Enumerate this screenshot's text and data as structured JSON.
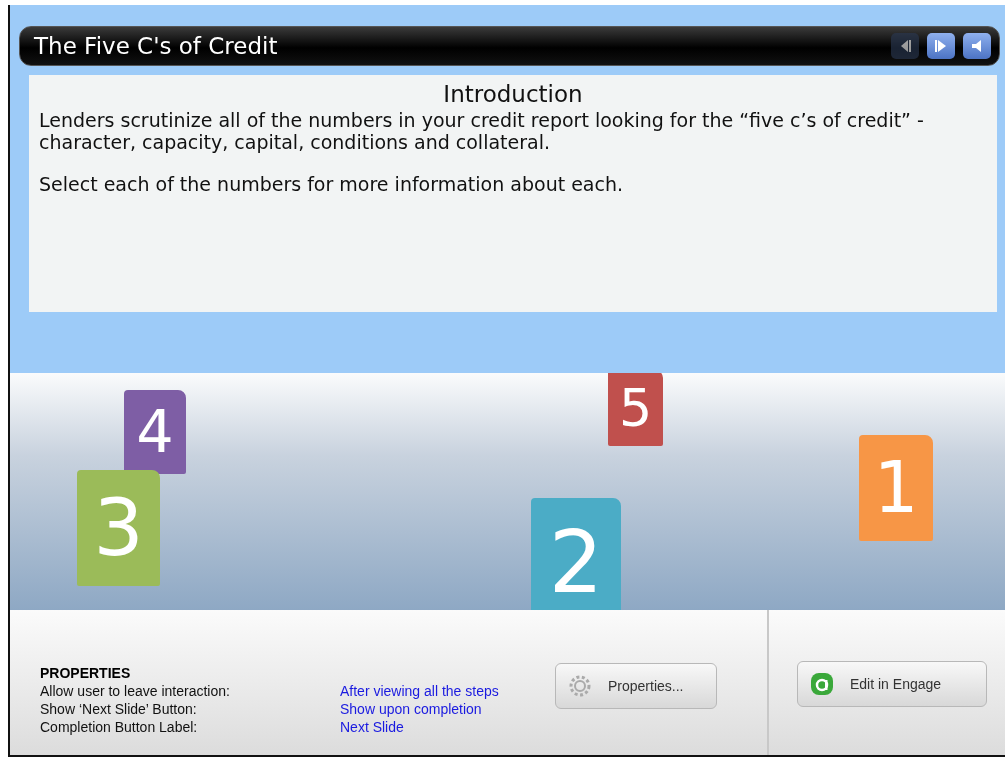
{
  "window": {
    "title": "The Five C's of Credit"
  },
  "nav_buttons": [
    {
      "kind": "previous",
      "disabled": true
    },
    {
      "kind": "next",
      "disabled": false
    },
    {
      "kind": "sound",
      "disabled": false
    }
  ],
  "intro": {
    "heading": "Introduction",
    "paragraphs": [
      "Lenders scrutinize all of the numbers in your credit report looking for the “five c’s of credit” - character, capacity, capital, conditions and collateral.",
      "Select each of the numbers for more information about each."
    ]
  },
  "tiles": [
    {
      "label": "4",
      "color": "#7e5ea5"
    },
    {
      "label": "3",
      "color": "#9bbb59"
    },
    {
      "label": "5",
      "color": "#c0504d"
    },
    {
      "label": "2",
      "color": "#4bacc6"
    },
    {
      "label": "1",
      "color": "#f79646"
    }
  ],
  "properties": {
    "heading": "PROPERTIES",
    "rows": [
      {
        "label": "Allow user to leave interaction:",
        "value": "After viewing all the steps"
      },
      {
        "label": "Show ‘Next Slide’ Button:",
        "value": "Show upon completion"
      },
      {
        "label": "Completion Button Label:",
        "value": "Next Slide"
      }
    ],
    "properties_button": "Properties...",
    "engage_button": "Edit in Engage"
  }
}
